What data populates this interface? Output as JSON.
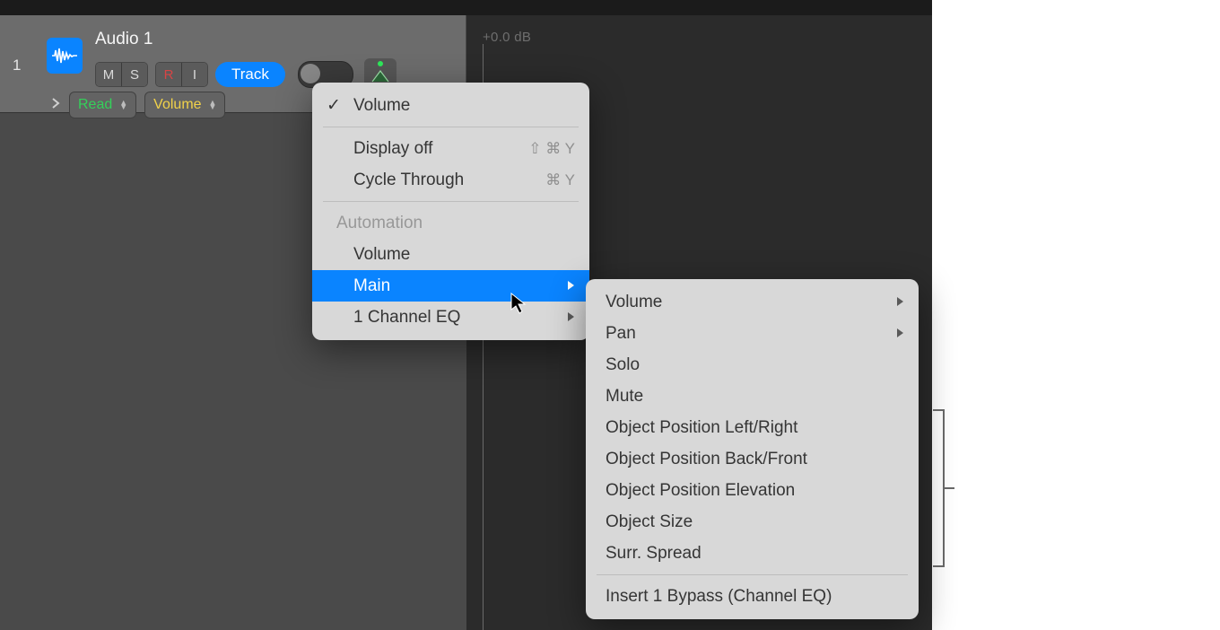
{
  "track": {
    "number": "1",
    "name": "Audio 1",
    "buttons": {
      "mute": "M",
      "solo": "S",
      "rec": "R",
      "input": "I",
      "mode": "Track"
    }
  },
  "db_label": "+0.0 dB",
  "automation_row": {
    "mode": "Read",
    "param": "Volume"
  },
  "menu1": {
    "current": "Volume",
    "display_off": {
      "label": "Display off",
      "shortcut": "⇧ ⌘ Y"
    },
    "cycle": {
      "label": "Cycle Through",
      "shortcut": "⌘ Y"
    },
    "section": "Automation",
    "items": {
      "volume": "Volume",
      "main": "Main",
      "chaneq": "1 Channel EQ"
    }
  },
  "menu2": {
    "volume": "Volume",
    "pan": "Pan",
    "solo": "Solo",
    "mute": "Mute",
    "obj_lr": "Object Position Left/Right",
    "obj_bf": "Object Position Back/Front",
    "obj_el": "Object Position Elevation",
    "obj_size": "Object Size",
    "surr": "Surr. Spread",
    "bypass": "Insert 1 Bypass (Channel EQ)"
  }
}
